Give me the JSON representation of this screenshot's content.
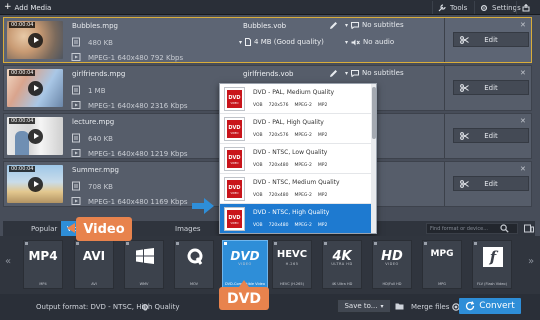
{
  "toolbar": {
    "add_media": "Add Media",
    "tools": "Tools",
    "settings": "Settings"
  },
  "files": [
    {
      "duration": "00:00:04",
      "name": "Bubbles.mpg",
      "size": "480 KB",
      "info": "MPEG-1 640x480 792 Kbps",
      "output_name": "Bubbles.vob",
      "output_size": "4 MB (Good quality)",
      "subtitles": "No subtitles",
      "audio": "No audio",
      "edit": "Edit",
      "selected": true
    },
    {
      "duration": "00:00:04",
      "name": "girlfriends.mpg",
      "size": "1 MB",
      "info": "MPEG-1 640x480 2316 Kbps",
      "output_name": "girlfriends.vob",
      "subtitles": "No subtitles",
      "edit": "Edit"
    },
    {
      "duration": "00:00:04",
      "name": "lecture.mpg",
      "size": "640 KB",
      "info": "MPEG-1 640x480 1219 Kbps",
      "edit": "Edit"
    },
    {
      "duration": "00:00:04",
      "name": "Summer.mpg",
      "size": "708 KB",
      "info": "MPEG-1 640x480 1169 Kbps",
      "edit": "Edit"
    }
  ],
  "presets": [
    {
      "title": "DVD - PAL, Medium Quality",
      "meta": [
        "VOB",
        "720x576",
        "MPEG-2",
        "MP2"
      ]
    },
    {
      "title": "DVD - PAL, High Quality",
      "meta": [
        "VOB",
        "720x576",
        "MPEG-2",
        "MP2"
      ]
    },
    {
      "title": "DVD - NTSC, Low Quality",
      "meta": [
        "VOB",
        "720x480",
        "MPEG-2",
        "MP2"
      ]
    },
    {
      "title": "DVD - NTSC, Medium Quality",
      "meta": [
        "VOB",
        "720x480",
        "MPEG-2",
        "MP2"
      ]
    },
    {
      "title": "DVD - NTSC, High Quality",
      "meta": [
        "VOB",
        "720x480",
        "MPEG-2",
        "MP2"
      ],
      "selected": true
    }
  ],
  "tabs": [
    "Popular",
    "Video",
    "Images"
  ],
  "search_placeholder": "Find format or device...",
  "formats": [
    {
      "logo": "MP4",
      "label": "MP4"
    },
    {
      "logo": "AVI",
      "label": "AVI"
    },
    {
      "logo": "WMV",
      "label": "WMV"
    },
    {
      "logo": "MOV",
      "label": "MOV"
    },
    {
      "logo": "DVD",
      "sub": "VIDEO",
      "label": "DVD-Compatible Video",
      "active": true
    },
    {
      "logo": "HEVC",
      "sub": "H.265",
      "label": "HEVC (H.265)"
    },
    {
      "logo": "4K",
      "sub": "ULTRA HD",
      "label": "4K Ultra HD"
    },
    {
      "logo": "HD",
      "sub": "VIDEO",
      "label": "HD/Full HD"
    },
    {
      "logo": "MPG",
      "label": "MPG"
    },
    {
      "logo": "FLV",
      "label": "FLV (Flash Video)"
    }
  ],
  "output_format": "Output format: DVD - NTSC, High Quality",
  "save_to": "Save to...",
  "merge_files": "Merge files",
  "convert": "Convert",
  "callouts": {
    "video": "Video",
    "dvd": "DVD"
  },
  "colors": {
    "accent": "#2e8ed8",
    "callout": "#e8834d",
    "selection": "#d9ad3a",
    "dvd_red": "#c9141b"
  }
}
